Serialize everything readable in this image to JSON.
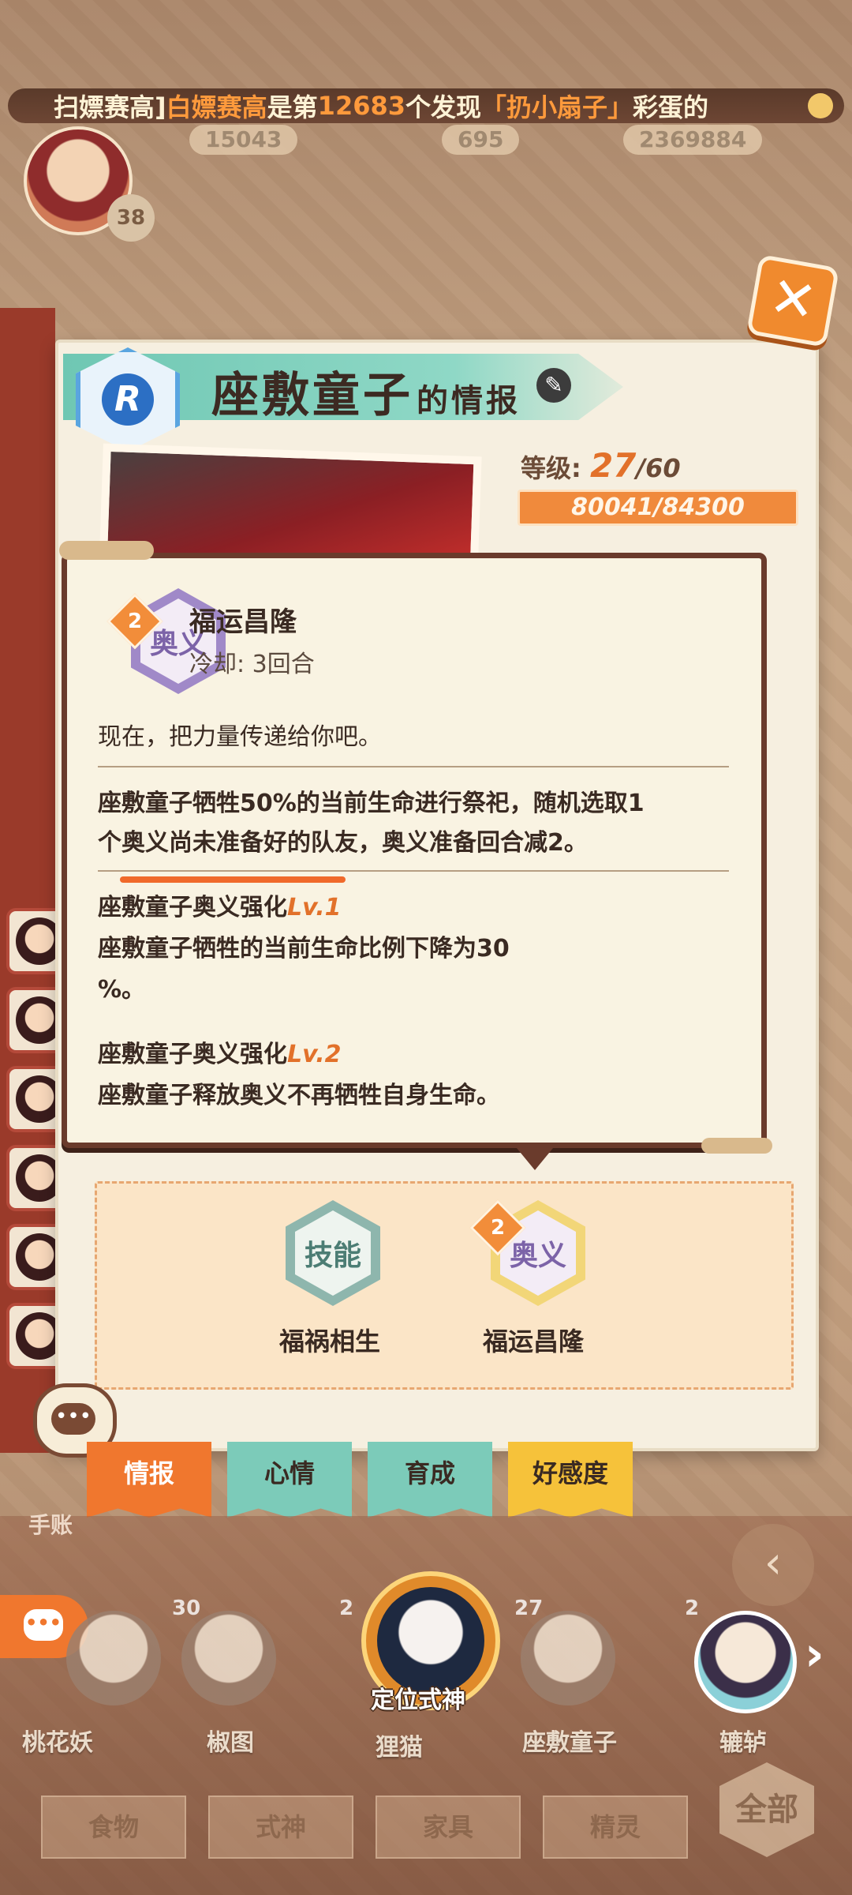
{
  "ticker": {
    "p1": "扫嫖赛高]",
    "p2": "白嫖赛高",
    "p3": "是第",
    "p4": "12683",
    "p5": "个发现",
    "p6": "「扔小扇子」",
    "p7": "彩蛋的"
  },
  "currency": {
    "stamina": "15043",
    "jade": "695",
    "coins": "2369884"
  },
  "player_level": "38",
  "panel": {
    "rarity": "R",
    "name": "座敷童子",
    "suffix": "的情报",
    "level_label": "等级:",
    "level": "27",
    "level_max": "/60",
    "exp": "80041/84300"
  },
  "tooltip": {
    "rank": "2",
    "skill_type": "奥义",
    "skill_name": "福运昌隆",
    "cooldown": "冷却: 3回合",
    "quote": "现在，把力量传递给你吧。",
    "effect_line1": "座敷童子牺牲50%的当前生命进行祭祀，随机选取1",
    "effect_line2": "个奥义尚未准备好的队友，奥义准备回合减2。",
    "up1_title": "座敷童子奥义强化",
    "up1_lv": "Lv.1",
    "up1_line1": "座敷童子牺牲的当前生命比例下降为30",
    "up1_line2": "%。",
    "up2_title": "座敷童子奥义强化",
    "up2_lv": "Lv.2",
    "up2_line1": "座敷童子释放奥义不再牺牲自身生命。"
  },
  "skills": [
    {
      "badge": "技能",
      "name": "福祸相生"
    },
    {
      "badge": "奥义",
      "name": "福运昌隆",
      "rank": "2"
    }
  ],
  "tabs": [
    {
      "label": "情报",
      "color": "#f0772e"
    },
    {
      "label": "心情",
      "color": "#7ccbb9"
    },
    {
      "label": "育成",
      "color": "#7ccbb9"
    },
    {
      "label": "好感度",
      "color": "#f6c23a"
    }
  ],
  "bottom": {
    "notebook": "手账",
    "locate": "定位式神",
    "shikigami": [
      {
        "name": "桃花妖",
        "level": ""
      },
      {
        "name": "椒图",
        "level": "30"
      },
      {
        "name": "狸猫",
        "level": "2"
      },
      {
        "name": "座敷童子",
        "level": "27"
      },
      {
        "name": "辘轳",
        "level": "2"
      }
    ],
    "categories": [
      "食物",
      "式神",
      "家具",
      "精灵"
    ],
    "all": "全部"
  },
  "colors": {
    "accent": "#f0772e",
    "teal": "#7ccbb9",
    "yellow": "#f6c23a",
    "frame": "#6a3b2c"
  }
}
